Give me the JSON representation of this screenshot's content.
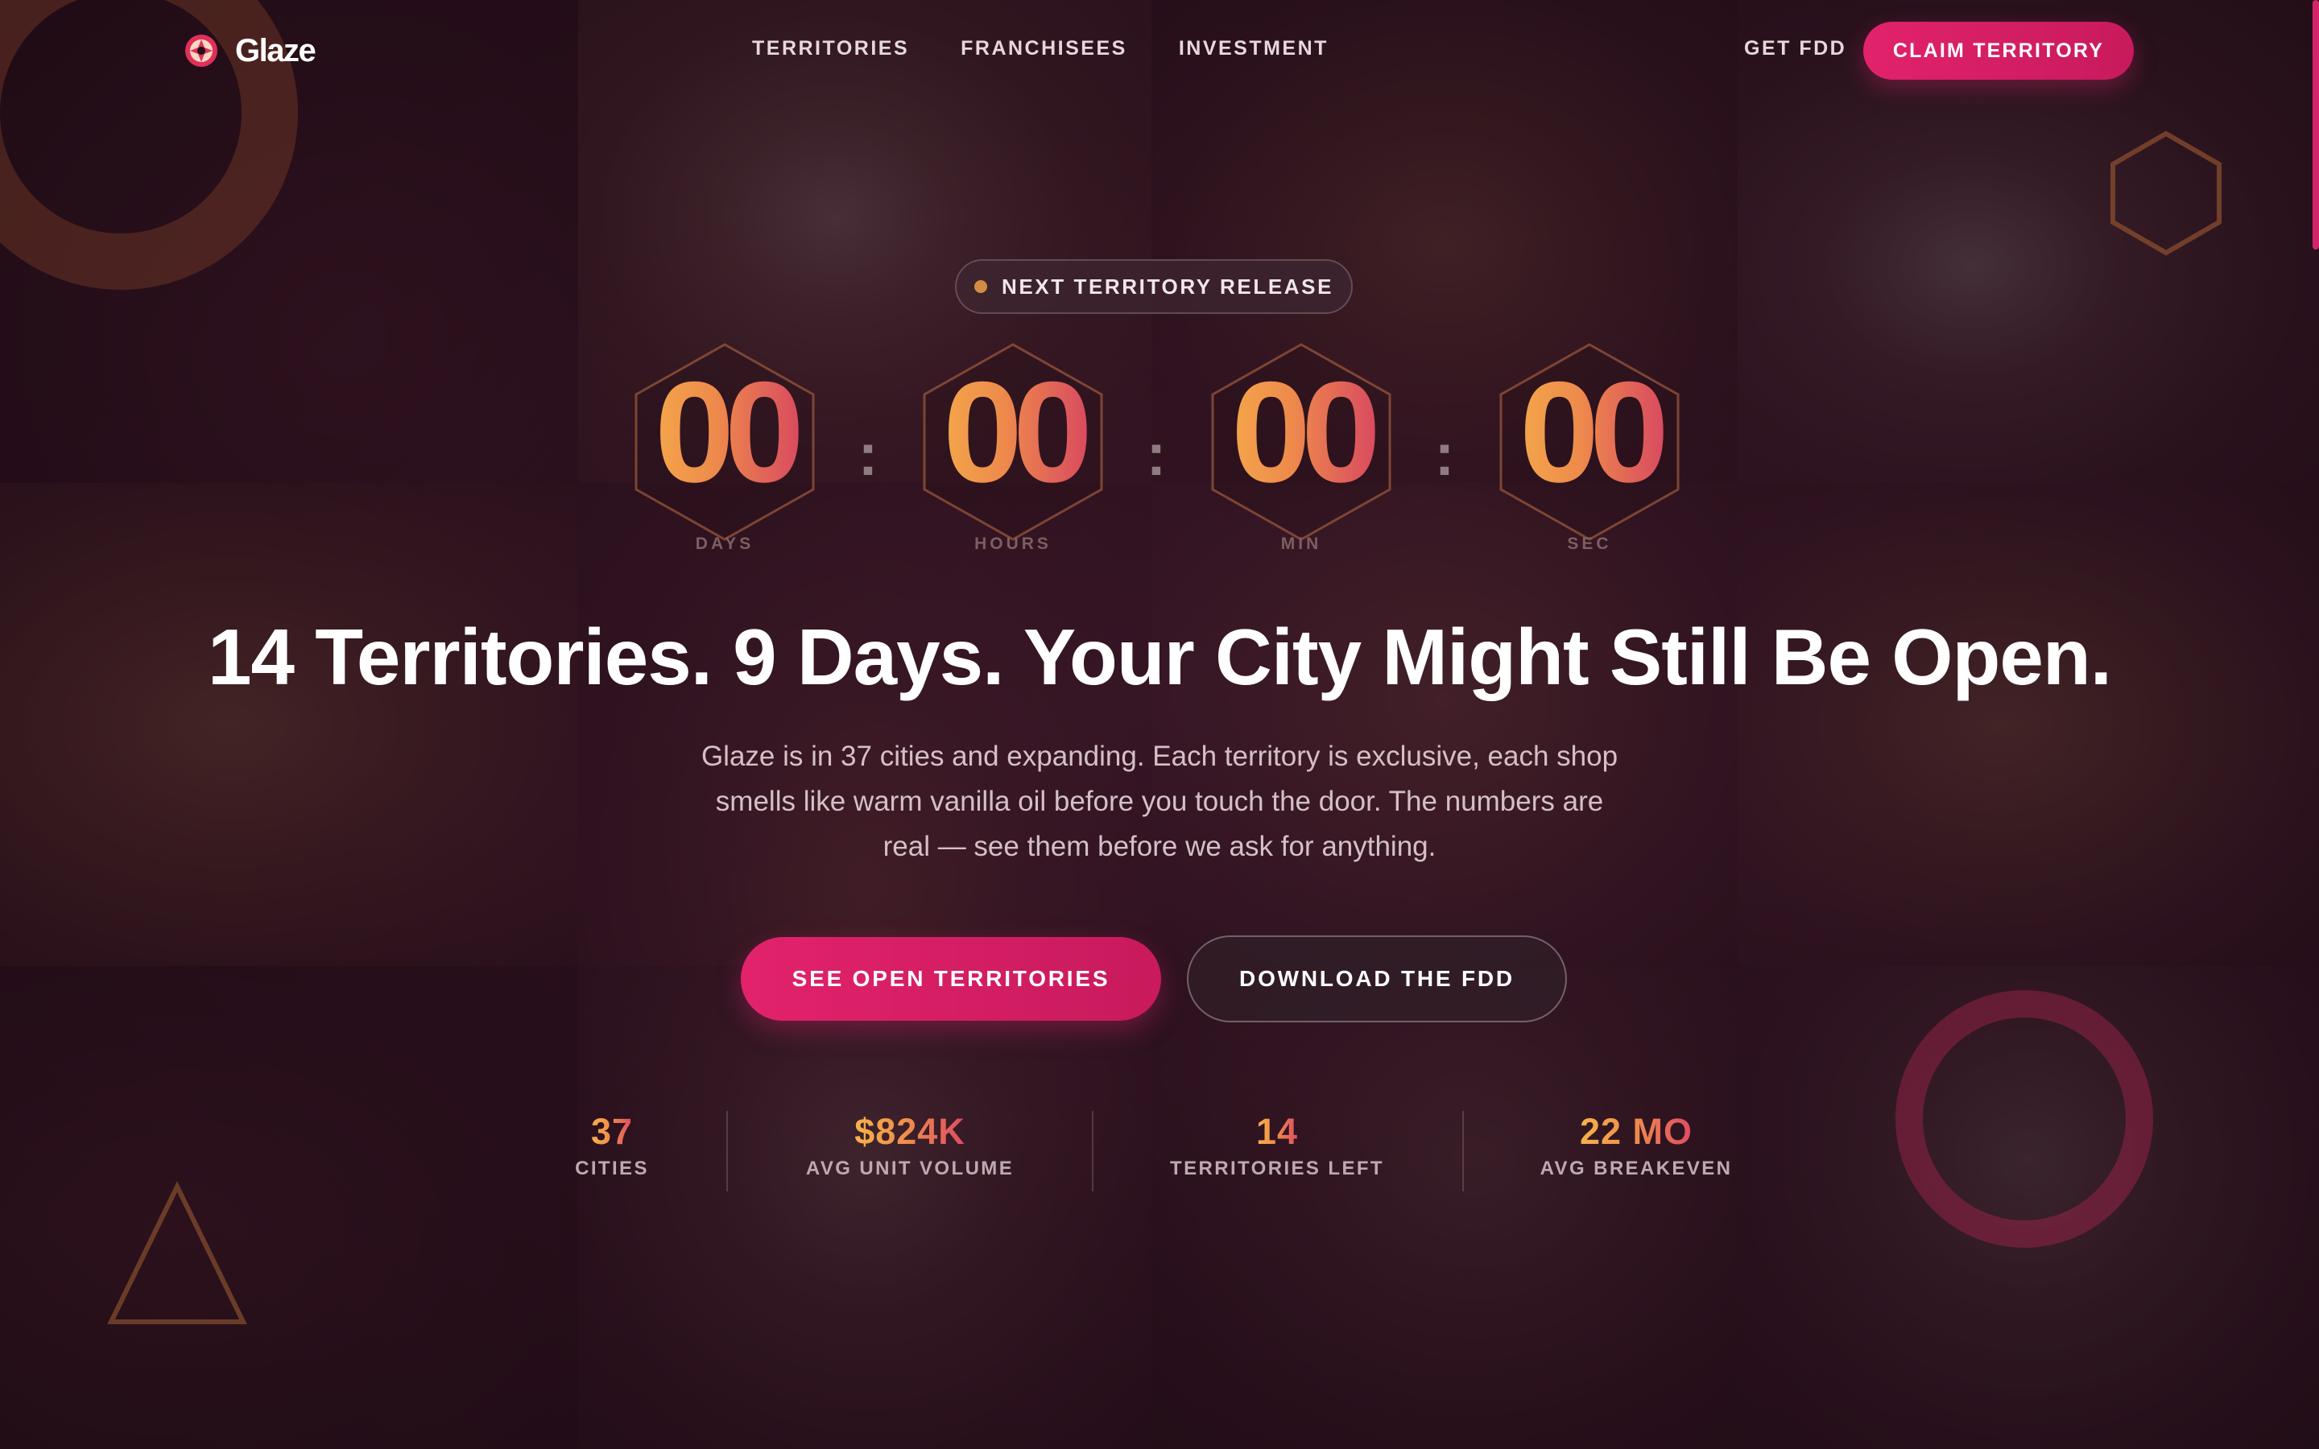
{
  "brand": {
    "name": "Glaze"
  },
  "nav": {
    "links": [
      "TERRITORIES",
      "FRANCHISEES",
      "INVESTMENT"
    ],
    "get_fdd": "GET FDD",
    "claim": "CLAIM TERRITORY"
  },
  "hero": {
    "badge": "NEXT TERRITORY RELEASE",
    "countdown": [
      {
        "value": "00",
        "label": "DAYS"
      },
      {
        "value": "00",
        "label": "HOURS"
      },
      {
        "value": "00",
        "label": "MIN"
      },
      {
        "value": "00",
        "label": "SEC"
      }
    ],
    "separator": ":",
    "headline": "14 Territories. 9 Days. Your City Might Still Be Open.",
    "subcopy": "Glaze is in 37 cities and expanding. Each territory is exclusive, each shop smells like warm vanilla oil before you touch the door. The numbers are real — see them before we ask for anything.",
    "primary_cta": "SEE OPEN TERRITORIES",
    "secondary_cta": "DOWNLOAD THE FDD"
  },
  "stats": [
    {
      "value": "37",
      "label": "CITIES"
    },
    {
      "value": "$824K",
      "label": "AVG UNIT VOLUME"
    },
    {
      "value": "14",
      "label": "TERRITORIES LEFT"
    },
    {
      "value": "22 MO",
      "label": "AVG BREAKEVEN"
    }
  ],
  "colors": {
    "accent": "#d6246a",
    "digit_gradient_start": "#f6b24a",
    "digit_gradient_end": "#d33a64",
    "background": "#231019"
  },
  "icons": {
    "logo": "donut-logo-icon",
    "badge_dot": "status-dot-icon"
  }
}
